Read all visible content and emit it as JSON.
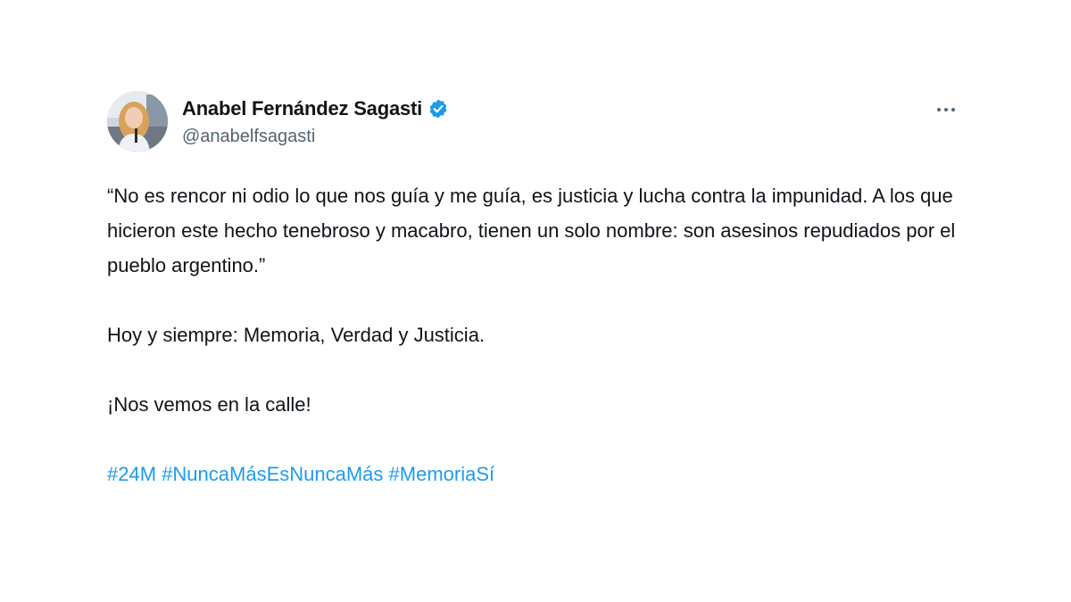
{
  "author": {
    "display_name": "Anabel Fernández Sagasti",
    "handle": "@anabelfsagasti",
    "verified_icon": "verified-badge-icon",
    "avatar": "profile-photo"
  },
  "menu": {
    "icon": "more-options-icon"
  },
  "tweet": {
    "paragraphs": [
      "“No es rencor ni odio lo que nos guía y me guía, es justicia y lucha contra la impunidad. A los que hicieron este hecho tenebroso y macabro, tienen un solo nombre: son asesinos repudiados por el pueblo argentino.”",
      "Hoy y siempre: Memoria, Verdad y Justicia.",
      "¡Nos vemos en la calle!"
    ],
    "hashtags": [
      "#24M",
      "#NuncaMásEsNuncaMás",
      "#MemoriaSí"
    ]
  },
  "colors": {
    "hashtag": "#1d9bf0",
    "verified": "#1d9bf0",
    "text": "#0f1419",
    "secondary": "#536471"
  }
}
